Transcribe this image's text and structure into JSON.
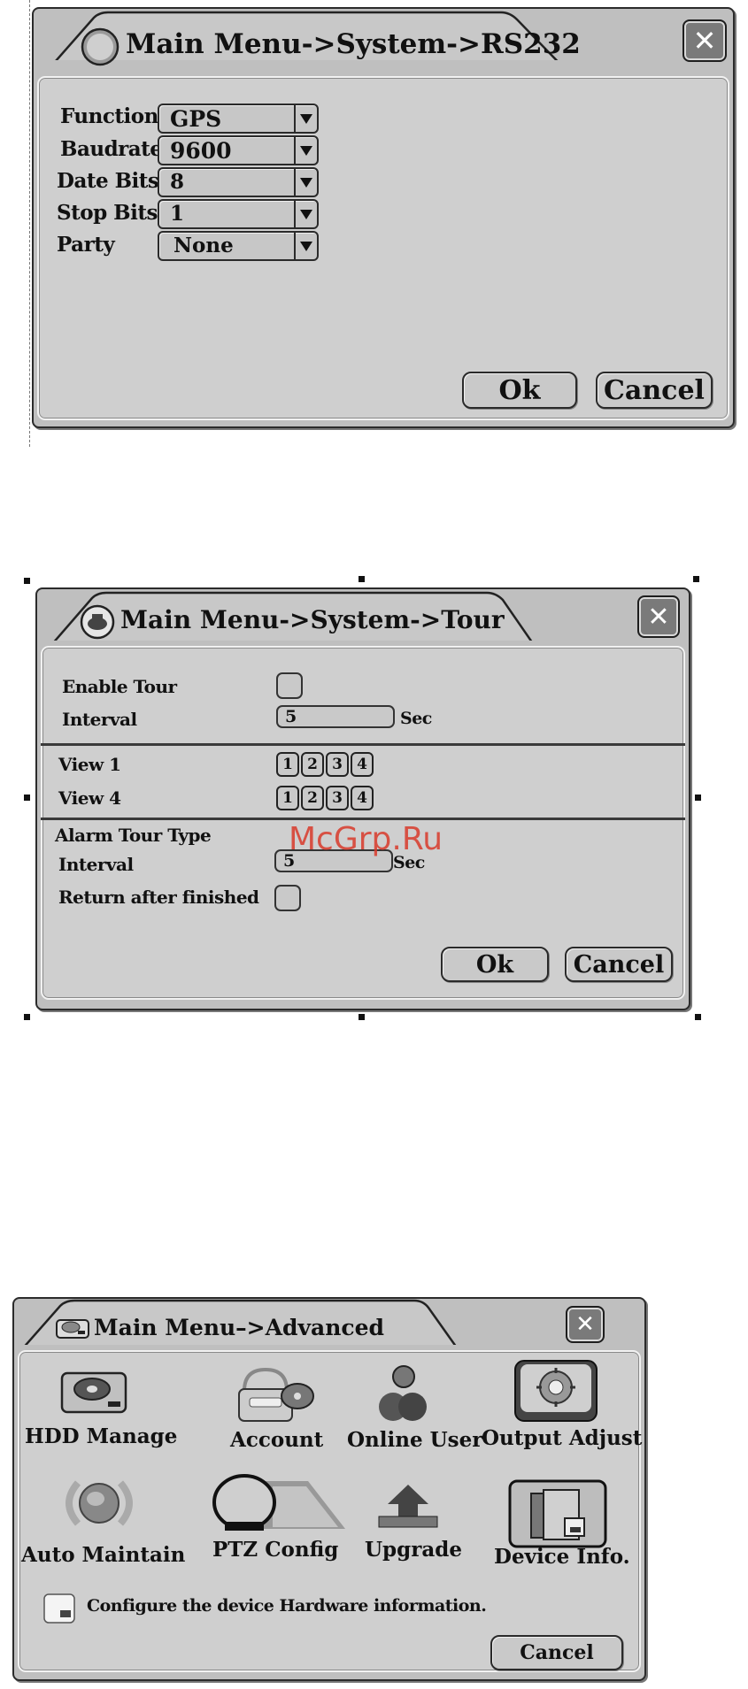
{
  "rs232": {
    "title": "Main Menu->System->RS232",
    "fields": [
      {
        "label": "Function",
        "value": "GPS"
      },
      {
        "label": "Baudrate",
        "value": "9600"
      },
      {
        "label": "Date Bits",
        "value": "8"
      },
      {
        "label": "Stop Bits",
        "value": "1"
      },
      {
        "label": "Party",
        "value": "None"
      }
    ],
    "ok": "Ok",
    "cancel": "Cancel"
  },
  "tour": {
    "title": "Main Menu->System->Tour",
    "enable_tour": "Enable Tour",
    "interval_label": "Interval",
    "interval_value": "5",
    "sec": "Sec",
    "view1": "View 1",
    "view4": "View 4",
    "channels": [
      "1",
      "2",
      "3",
      "4"
    ],
    "alarm_tour_type": "Alarm Tour  Type",
    "alarm_interval_label": "Interval",
    "alarm_interval_value": "5",
    "alarm_sec": "Sec",
    "return_after": "Return after finished",
    "ok": "Ok",
    "cancel": "Cancel"
  },
  "watermark": "McGrp.Ru",
  "advanced": {
    "title": "Main Menu–>Advanced",
    "items": [
      {
        "label": "HDD Manage",
        "icon": "hdd-icon"
      },
      {
        "label": "Account",
        "icon": "account-icon"
      },
      {
        "label": "Online User",
        "icon": "online-user-icon"
      },
      {
        "label": "Output Adjust",
        "icon": "output-adjust-icon"
      },
      {
        "label": "Auto Maintain",
        "icon": "auto-maintain-icon"
      },
      {
        "label": "PTZ Config",
        "icon": "ptz-config-icon"
      },
      {
        "label": "Upgrade",
        "icon": "upgrade-icon"
      },
      {
        "label": "Device Info.",
        "icon": "device-info-icon"
      }
    ],
    "hint": "Configure the device Hardware information.",
    "cancel": "Cancel"
  }
}
